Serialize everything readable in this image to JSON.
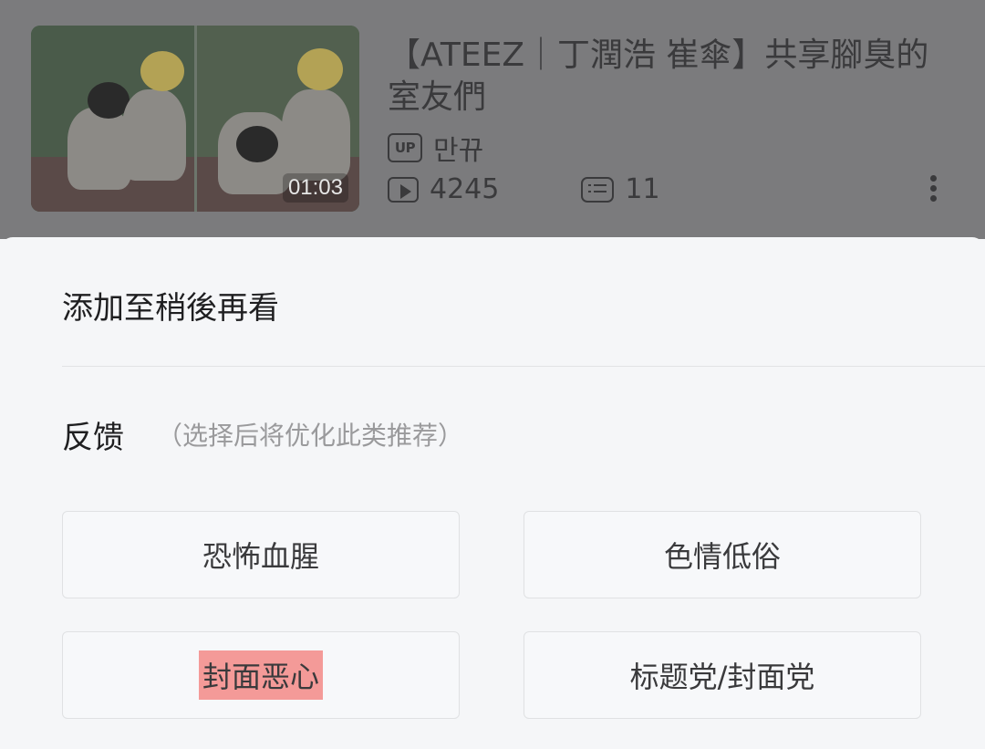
{
  "video": {
    "title": "【ATEEZ｜丁潤浩 崔傘】共享腳臭的室友們",
    "duration": "01:03",
    "up_badge": "UP",
    "uploader": "만뀨",
    "views": "4245",
    "danmaku": "11"
  },
  "sheet": {
    "watch_later": "添加至稍後再看",
    "feedback_title": "反馈",
    "feedback_hint": "（选择后将优化此类推荐）",
    "options": [
      "恐怖血腥",
      "色情低俗",
      "封面恶心",
      "标题党/封面党"
    ],
    "highlight_color": "#f49a98"
  }
}
